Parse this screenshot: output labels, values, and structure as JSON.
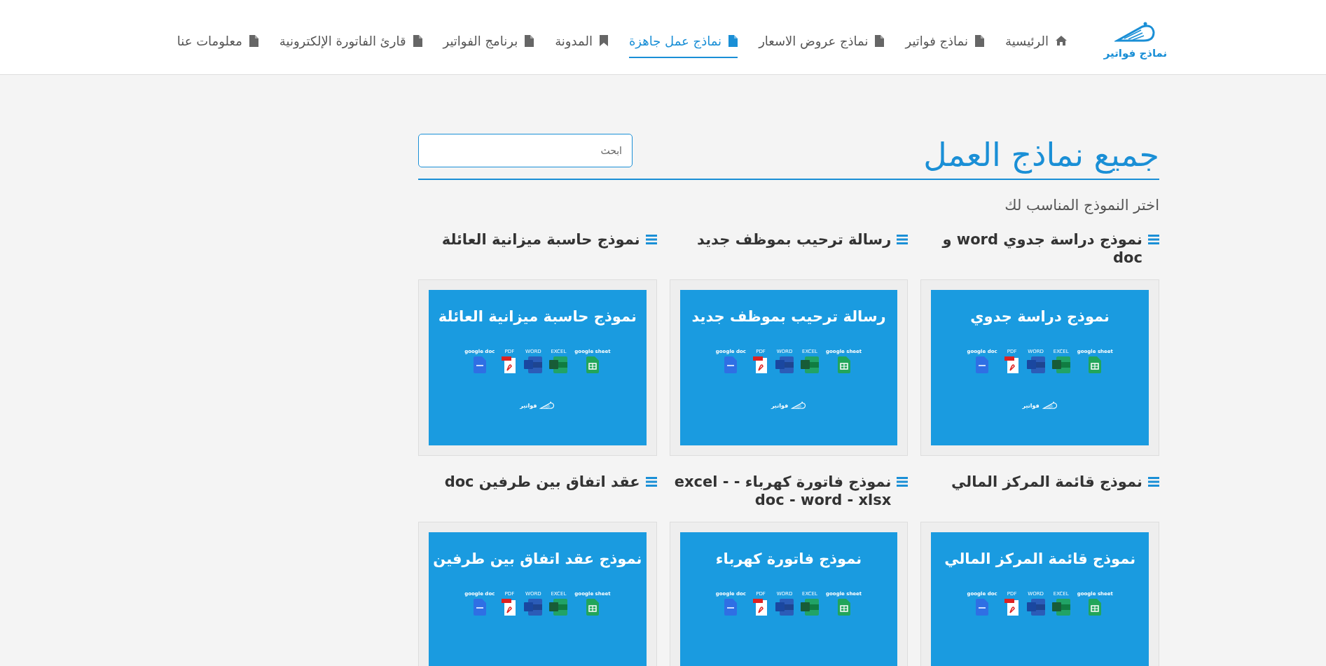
{
  "logo": {
    "text": "نماذج فواتير"
  },
  "nav": [
    {
      "label": "الرئيسية",
      "kind": "home",
      "selected": false
    },
    {
      "label": "نماذج فواتير",
      "kind": "file",
      "selected": false
    },
    {
      "label": "نماذج عروض الاسعار",
      "kind": "file",
      "selected": false
    },
    {
      "label": "نماذج عمل جاهزة",
      "kind": "file",
      "selected": true
    },
    {
      "label": "المدونة",
      "kind": "bookmark",
      "selected": false
    },
    {
      "label": "برنامج الفواتير",
      "kind": "file",
      "selected": false
    },
    {
      "label": "قارئ الفاتورة الإلكترونية",
      "kind": "file",
      "selected": false
    },
    {
      "label": "معلومات عنا",
      "kind": "file",
      "selected": false
    }
  ],
  "page": {
    "title": "جميع نماذج العمل",
    "search": {
      "placeholder": "ابحث"
    },
    "subtitle": "اختر النموذج المناسب لك"
  },
  "cards": [
    {
      "heading": "نموذج دراسة جدوي word و doc",
      "thumb": {
        "title": "نموذج دراسة جدوي",
        "brand": "فواتير",
        "formats": [
          {
            "label": "google sheet",
            "kind": "sheet"
          },
          {
            "label": "EXCEL",
            "kind": "excel"
          },
          {
            "label": "WORD",
            "kind": "word"
          },
          {
            "label": "PDF",
            "kind": "pdf"
          },
          {
            "label": "google doc",
            "kind": "doc"
          }
        ]
      }
    },
    {
      "heading": "رسالة ترحيب بموظف جديد",
      "thumb": {
        "title": "رسالة ترحيب بموظف جديد",
        "brand": "فواتير",
        "formats": [
          {
            "label": "google sheet",
            "kind": "sheet"
          },
          {
            "label": "EXCEL",
            "kind": "excel"
          },
          {
            "label": "WORD",
            "kind": "word"
          },
          {
            "label": "PDF",
            "kind": "pdf"
          },
          {
            "label": "google doc",
            "kind": "doc"
          }
        ]
      }
    },
    {
      "heading": "نموذج حاسبة ميزانية العائلة",
      "thumb": {
        "title": "نموذج حاسبة ميزانية العائلة",
        "brand": "فواتير",
        "formats": [
          {
            "label": "google sheet",
            "kind": "sheet"
          },
          {
            "label": "EXCEL",
            "kind": "excel"
          },
          {
            "label": "WORD",
            "kind": "word"
          },
          {
            "label": "PDF",
            "kind": "pdf"
          },
          {
            "label": "google doc",
            "kind": "doc"
          }
        ]
      }
    },
    {
      "heading": "نموذج قائمة المركز المالي",
      "thumb": {
        "title": "نموذج قائمة المركز المالي",
        "formats": [
          {
            "label": "google sheet",
            "kind": "sheet"
          },
          {
            "label": "EXCEL",
            "kind": "excel"
          },
          {
            "label": "WORD",
            "kind": "word"
          },
          {
            "label": "PDF",
            "kind": "pdf"
          },
          {
            "label": "google doc",
            "kind": "doc"
          }
        ]
      }
    },
    {
      "heading": "نموذج فاتورة كهرباء - excel - doc - word - xlsx",
      "thumb": {
        "title": "نموذج فاتورة كهرباء",
        "formats": [
          {
            "label": "google sheet",
            "kind": "sheet"
          },
          {
            "label": "EXCEL",
            "kind": "excel"
          },
          {
            "label": "WORD",
            "kind": "word"
          },
          {
            "label": "PDF",
            "kind": "pdf"
          },
          {
            "label": "google doc",
            "kind": "doc"
          }
        ]
      }
    },
    {
      "heading": "عقد اتفاق بين طرفين doc",
      "thumb": {
        "title": "نموذج عقد اتفاق بين طرفين",
        "formats": [
          {
            "label": "google sheet",
            "kind": "sheet"
          },
          {
            "label": "EXCEL",
            "kind": "excel"
          },
          {
            "label": "WORD",
            "kind": "word"
          },
          {
            "label": "PDF",
            "kind": "pdf"
          },
          {
            "label": "google doc",
            "kind": "doc"
          }
        ]
      }
    }
  ]
}
